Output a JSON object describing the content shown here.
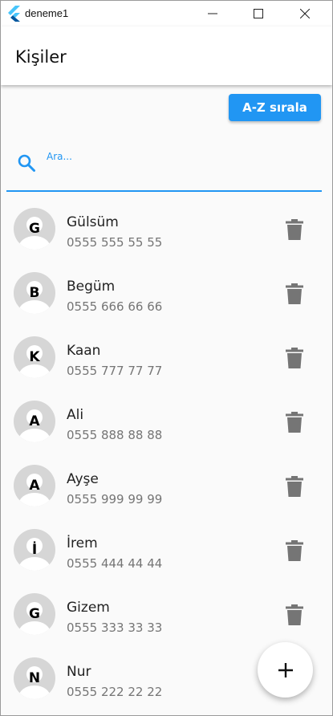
{
  "window": {
    "title": "deneme1",
    "controls": [
      "minimize-icon",
      "maximize-icon",
      "close-icon"
    ]
  },
  "appbar": {
    "title": "Kişiler"
  },
  "toolbar": {
    "sort_label": "A-Z sırala"
  },
  "search": {
    "placeholder": "Ara...",
    "value": "",
    "icon": "search-icon"
  },
  "contacts": [
    {
      "initial": "G",
      "name": "Gülsüm",
      "phone": "0555 555 55 55"
    },
    {
      "initial": "B",
      "name": "Begüm",
      "phone": "0555 666 66 66"
    },
    {
      "initial": "K",
      "name": "Kaan",
      "phone": "0555 777 77 77"
    },
    {
      "initial": "A",
      "name": "Ali",
      "phone": "0555 888 88 88"
    },
    {
      "initial": "A",
      "name": "Ayşe",
      "phone": "0555 999 99 99"
    },
    {
      "initial": "İ",
      "name": "İrem",
      "phone": "0555 444 44 44"
    },
    {
      "initial": "G",
      "name": "Gizem",
      "phone": "0555 333 33 33"
    },
    {
      "initial": "N",
      "name": "Nur",
      "phone": "0555 222 22 22"
    }
  ],
  "fab": {
    "icon": "plus-icon"
  },
  "colors": {
    "accent": "#2196f3",
    "delete_icon": "#757575",
    "avatar_bg": "#d6d6d6",
    "background": "#fafafa"
  }
}
